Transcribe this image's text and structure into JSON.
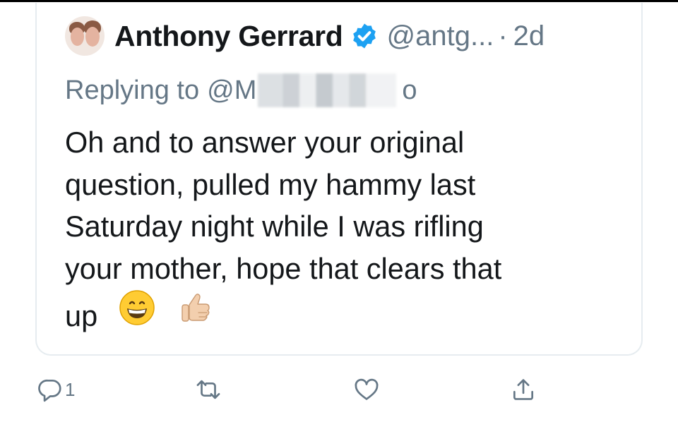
{
  "tweet": {
    "author_name": "Anthony Gerrard",
    "handle": "@antg...",
    "separator": "·",
    "age": "2d",
    "verified_icon": "verified-badge-icon",
    "replying_prefix": "Replying to",
    "replying_mention_start": "@M",
    "replying_mention_end": "o",
    "body_lines": [
      "Oh and to answer your original",
      "question, pulled my hammy last",
      "Saturday night while I was rifling",
      "your mother, hope that clears that",
      "up"
    ],
    "emojis": [
      "grinning-face-icon",
      "thumbs-up-icon"
    ]
  },
  "actions": {
    "reply_count": "1",
    "icons": [
      "reply-icon",
      "retweet-icon",
      "like-icon",
      "share-icon"
    ]
  },
  "colors": {
    "text": "#14171a",
    "secondary": "#657786",
    "verified": "#1da1f2",
    "border": "#e6ecf0"
  }
}
